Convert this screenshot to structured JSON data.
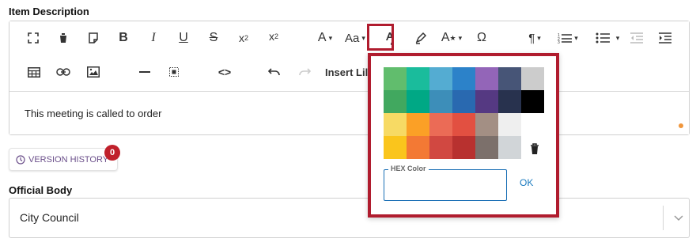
{
  "item_description_label": "Item Description",
  "toolbar": {
    "insert_label": "Insert Lil",
    "icons": [
      "fullscreen-icon",
      "trash-icon",
      "paste-icon",
      "bold-icon",
      "italic-icon",
      "underline-icon",
      "strikethrough-icon",
      "subscript-icon",
      "superscript-icon",
      "font-size-icon",
      "text-case-icon",
      "text-color-icon",
      "highlight-icon",
      "font-style-icon",
      "special-character-icon",
      "paragraph-icon",
      "ordered-list-icon",
      "unordered-list-icon",
      "outdent-icon",
      "indent-icon",
      "table-icon",
      "link-icon",
      "image-icon",
      "horizontal-line-icon",
      "select-all-icon",
      "code-view-icon",
      "undo-icon",
      "redo-icon"
    ]
  },
  "editor": {
    "content": "This meeting is called to order"
  },
  "version_history": {
    "label": "VERSION HISTORY",
    "count": "0"
  },
  "official_body": {
    "label": "Official Body",
    "value": "City Council"
  },
  "color_popup": {
    "swatches": [
      "#61bd6d",
      "#1abc9c",
      "#54acd2",
      "#2c82c9",
      "#9365b8",
      "#475577",
      "#cccccc",
      "#41a85f",
      "#00a885",
      "#3d8eb9",
      "#2969b0",
      "#553982",
      "#28324e",
      "#000000",
      "#f7da64",
      "#fba026",
      "#eb6b56",
      "#e25041",
      "#a38f84",
      "#efefef",
      "",
      "#fac51c",
      "#f37934",
      "#d14841",
      "#b8312f",
      "#7c706b",
      "#d1d5d8",
      ""
    ],
    "hex_label": "HEX Color",
    "hex_value": "",
    "ok_label": "OK"
  },
  "colors": {
    "accent_red": "#b01c2e",
    "link_blue": "#1a7abf",
    "version_purple": "#6b4f8a"
  }
}
